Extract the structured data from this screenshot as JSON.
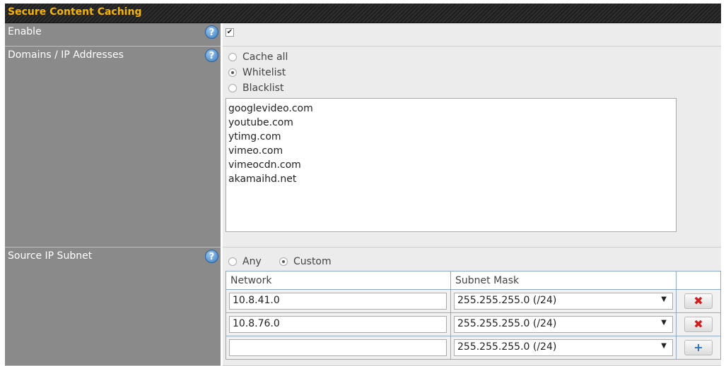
{
  "section": {
    "title": "Secure Content Caching"
  },
  "enable": {
    "label": "Enable",
    "checked": true,
    "check_glyph": "✔"
  },
  "domains": {
    "label": "Domains / IP Addresses",
    "options": [
      {
        "label": "Cache all",
        "checked": false
      },
      {
        "label": "Whitelist",
        "checked": true
      },
      {
        "label": "Blacklist",
        "checked": false
      }
    ],
    "list_text": "googlevideo.com\nyoutube.com\nytimg.com\nvimeo.com\nvimeocdn.com\nakamaihd.net"
  },
  "source_subnet": {
    "label": "Source IP Subnet",
    "options": [
      {
        "label": "Any",
        "checked": false
      },
      {
        "label": "Custom",
        "checked": true
      }
    ],
    "headers": {
      "network": "Network",
      "subnet_mask": "Subnet Mask"
    },
    "rows": [
      {
        "network": "10.8.41.0",
        "mask": "255.255.255.0 (/24)",
        "action": "delete",
        "action_glyph": "✖"
      },
      {
        "network": "10.8.76.0",
        "mask": "255.255.255.0 (/24)",
        "action": "delete",
        "action_glyph": "✖"
      },
      {
        "network": "",
        "mask": "255.255.255.0 (/24)",
        "action": "add",
        "action_glyph": "+"
      }
    ]
  },
  "help_glyph": "?",
  "select_arrow": "▼",
  "colors": {
    "title": "#f5b400",
    "label_bg": "#8a8a8a",
    "delete": "#d01c1c",
    "add": "#2c6fc1"
  }
}
